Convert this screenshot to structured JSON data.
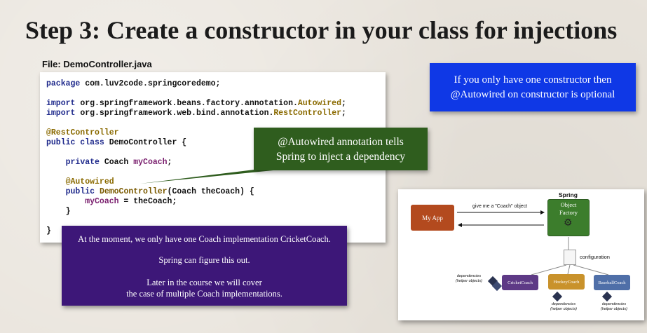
{
  "slide": {
    "title": "Step 3: Create a constructor in your class for injections",
    "file_label": "File: DemoController.java"
  },
  "code": {
    "lines": [
      "package com.luv2code.springcoredemo;",
      "import org.springframework.beans.factory.annotation.Autowired;",
      "import org.springframework.web.bind.annotation.RestController;",
      "@RestController",
      "public class DemoController {",
      "    private Coach myCoach;",
      "    @Autowired",
      "    public DemoController(Coach theCoach) {",
      "        myCoach = theCoach;",
      "    }",
      "}"
    ]
  },
  "callouts": {
    "blue_line1": "If you only have one constructor then",
    "blue_line2": "@Autowired on constructor is optional",
    "green_line1": "@Autowired annotation tells",
    "green_line2": "Spring to inject a dependency",
    "purple_p1": "At the moment, we only have one Coach implementation CricketCoach.",
    "purple_p2": "Spring can figure this out.",
    "purple_p3a": "Later in the course we will cover",
    "purple_p3b": "the case of multiple Coach implementations."
  },
  "diagram": {
    "spring_label": "Spring",
    "my_app": "My App",
    "factory_line1": "Object",
    "factory_line2": "Factory",
    "give_me": "give me a \"Coach\" object",
    "configuration": "configuration",
    "cricket": "CricketCoach",
    "hockey": "HockeyCoach",
    "baseball": "BaseballCoach",
    "dependencies": "dependencies",
    "helper_objects": "(helper objects)"
  },
  "colors": {
    "blue_callout": "#0f38e6",
    "green_callout": "#2f5d1e",
    "purple_callout": "#3d1778"
  }
}
